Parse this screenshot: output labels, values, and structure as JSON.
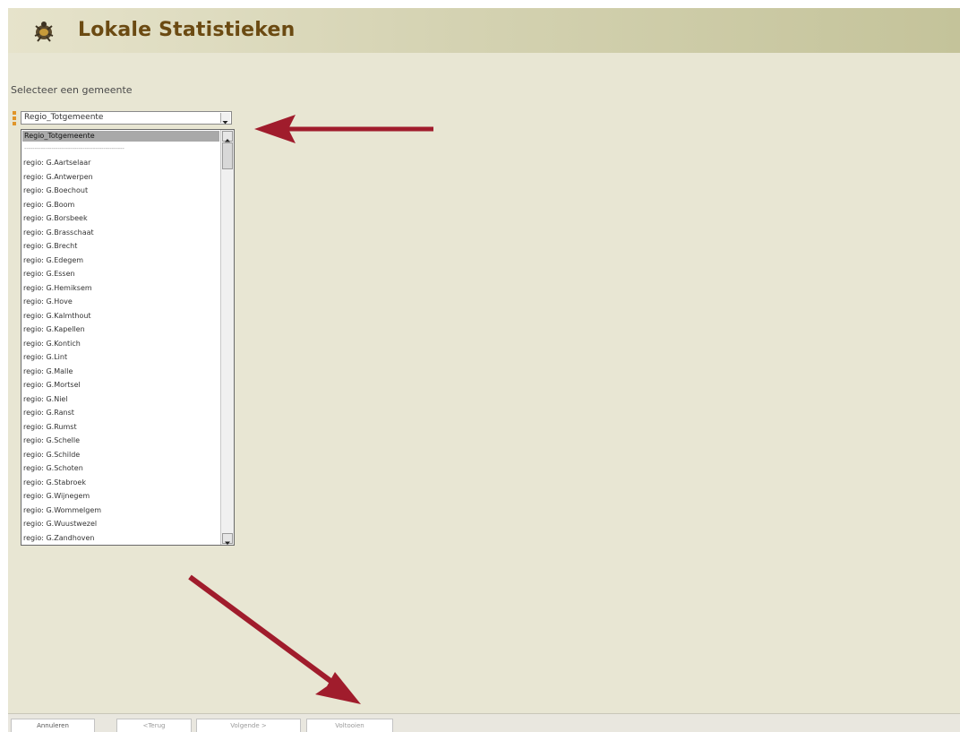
{
  "app": {
    "title": "Lokale Statistieken",
    "logo_icon": "insect-crest-icon"
  },
  "form": {
    "prompt": "Selecteer een gemeente",
    "select_value": "Regio_Totgemeente",
    "dropdown": {
      "selected_option": "Regio_Totgemeente",
      "separator": "------------------------------------------------",
      "options": [
        "regio: G.Aartselaar",
        "regio: G.Antwerpen",
        "regio: G.Boechout",
        "regio: G.Boom",
        "regio: G.Borsbeek",
        "regio: G.Brasschaat",
        "regio: G.Brecht",
        "regio: G.Edegem",
        "regio: G.Essen",
        "regio: G.Hemiksem",
        "regio: G.Hove",
        "regio: G.Kalmthout",
        "regio: G.Kapellen",
        "regio: G.Kontich",
        "regio: G.Lint",
        "regio: G.Malle",
        "regio: G.Mortsel",
        "regio: G.Niel",
        "regio: G.Ranst",
        "regio: G.Rumst",
        "regio: G.Schelle",
        "regio: G.Schilde",
        "regio: G.Schoten",
        "regio: G.Stabroek",
        "regio: G.Wijnegem",
        "regio: G.Wommelgem",
        "regio: G.Wuustwezel",
        "regio: G.Zandhoven"
      ]
    }
  },
  "footer": {
    "buttons": [
      {
        "label": "Annuleren",
        "enabled": true
      },
      {
        "label": "<Terug",
        "enabled": false
      },
      {
        "label": "Volgende >",
        "enabled": false
      },
      {
        "label": "Voltooien",
        "enabled": false
      }
    ]
  },
  "colors": {
    "background": "#e8e6d3",
    "header_start": "#e6e3cb",
    "header_end": "#c4c39a",
    "title": "#6b4a12",
    "annotation_arrow": "#a01c2c",
    "required_marker": "#e0952a"
  }
}
